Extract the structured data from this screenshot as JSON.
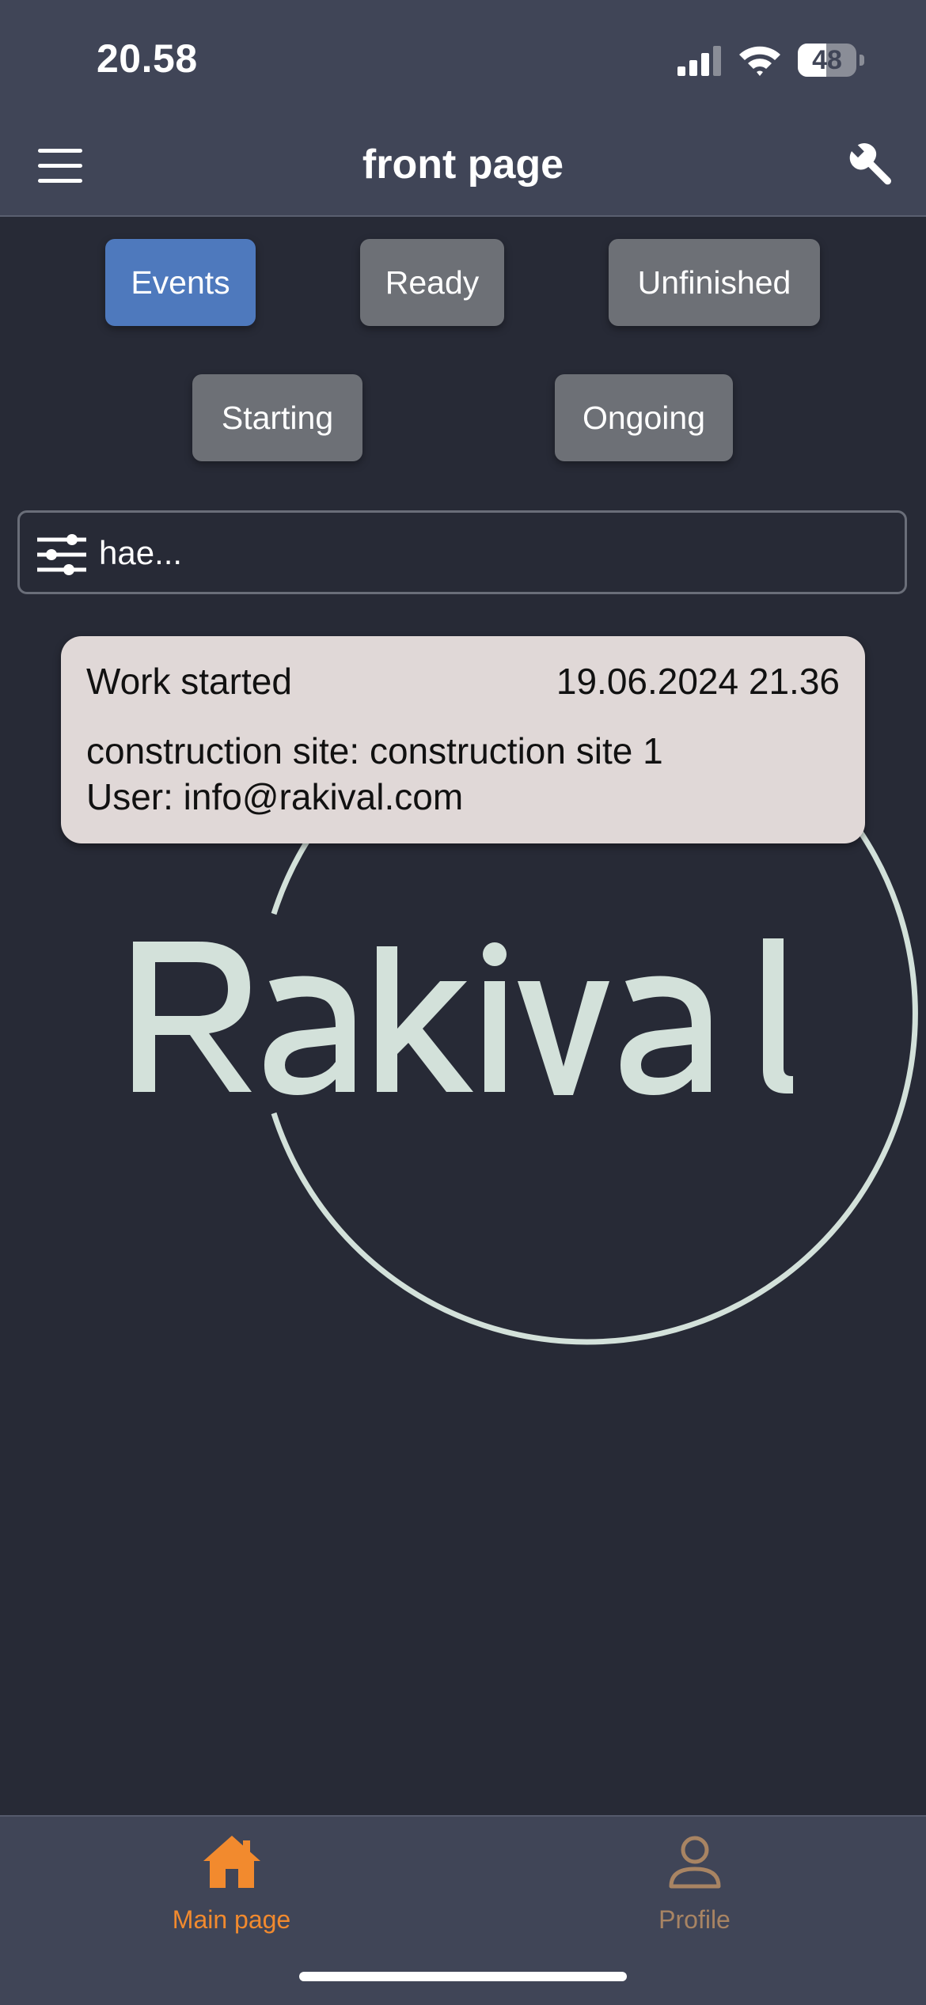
{
  "status_bar": {
    "time": "20.58",
    "battery_level": "48",
    "battery_fraction": 0.48
  },
  "header": {
    "title": "front page",
    "menu_icon": "hamburger-menu-icon",
    "settings_icon": "wrench-icon"
  },
  "filters": [
    {
      "label": "Events",
      "active": true
    },
    {
      "label": "Ready",
      "active": false
    },
    {
      "label": "Unfinished",
      "active": false
    },
    {
      "label": "Starting",
      "active": false
    },
    {
      "label": "Ongoing",
      "active": false
    }
  ],
  "search": {
    "placeholder": "hae...",
    "value": "",
    "icon": "sliders-icon"
  },
  "events": [
    {
      "title": "Work started",
      "date": "19.06.2024 21.36",
      "site": "construction site: construction site 1",
      "user": "User: info@rakival.com"
    }
  ],
  "watermark": {
    "text": "Rakival"
  },
  "bottom_nav": {
    "items": [
      {
        "label": "Main page",
        "icon": "home-icon",
        "active": true
      },
      {
        "label": "Profile",
        "icon": "person-icon",
        "active": false
      }
    ]
  },
  "colors": {
    "header_bg": "#404557",
    "page_bg": "#272a36",
    "active_filter": "#4e79bd",
    "inactive_filter": "#6d7076",
    "card_bg": "#e0d8d7",
    "nav_active": "#f28a2e",
    "logo": "#d3e1da"
  }
}
